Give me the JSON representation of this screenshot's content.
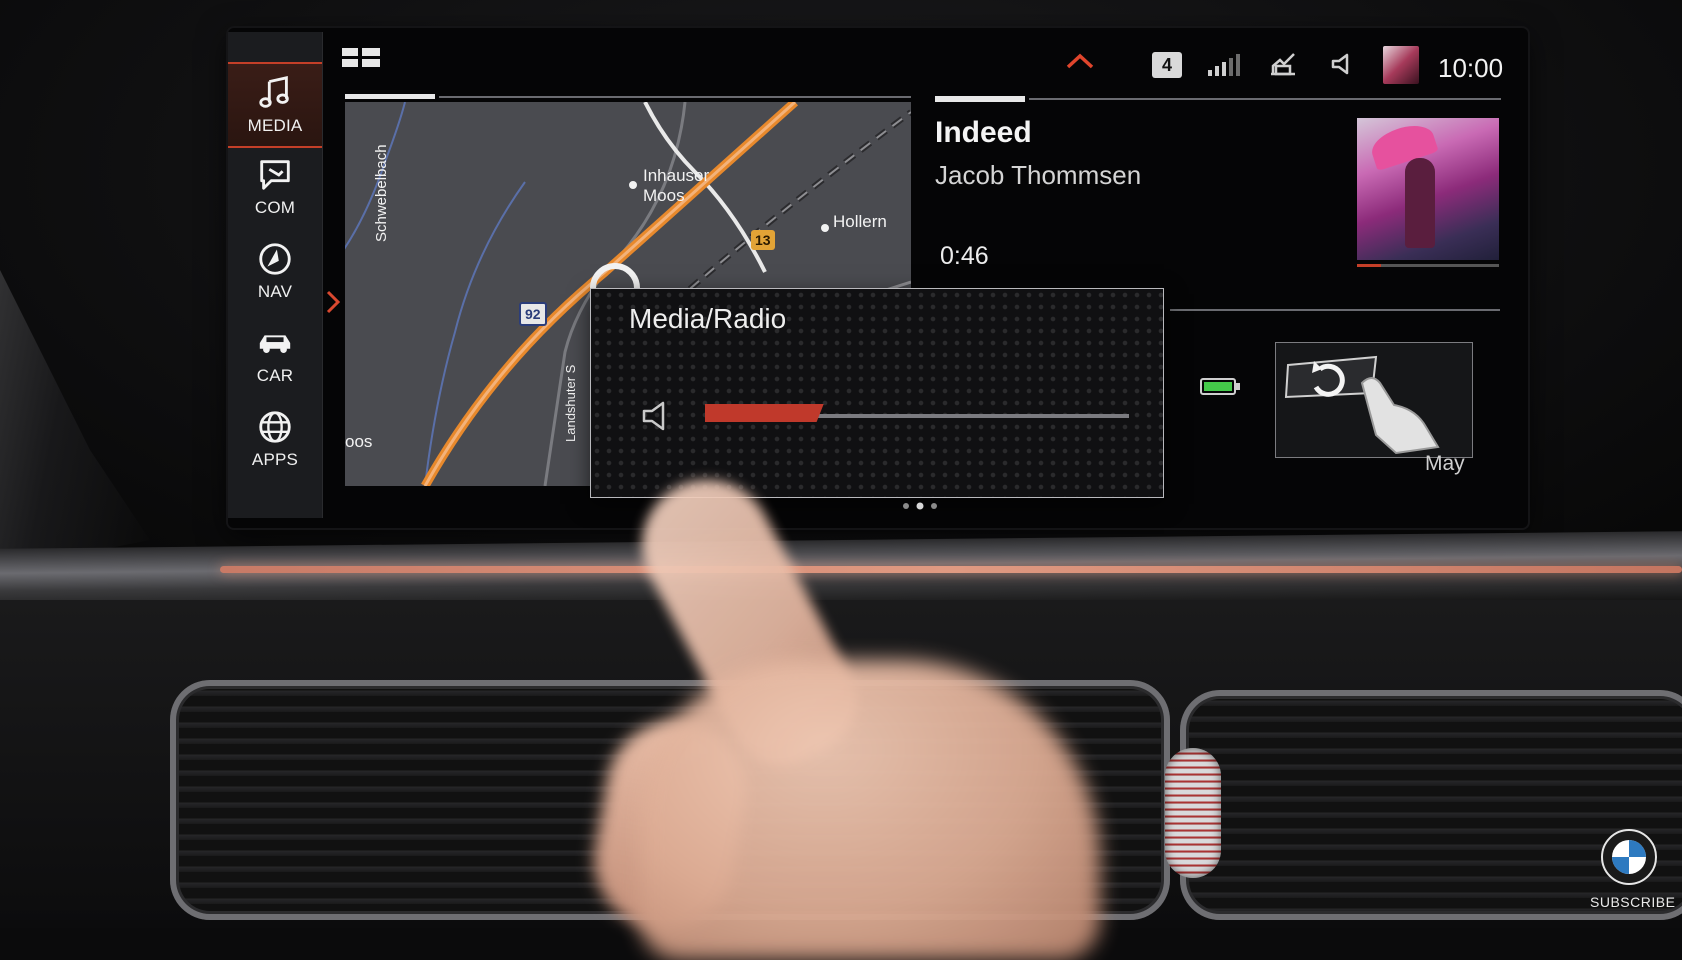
{
  "sidebar": {
    "items": [
      {
        "label": "MEDIA",
        "icon": "music-note-icon",
        "active": true
      },
      {
        "label": "COM",
        "icon": "communication-icon",
        "active": false
      },
      {
        "label": "NAV",
        "icon": "navigation-icon",
        "active": false
      },
      {
        "label": "CAR",
        "icon": "car-icon",
        "active": false
      },
      {
        "label": "APPS",
        "icon": "globe-icon",
        "active": false
      }
    ],
    "accent_color": "#c43f28"
  },
  "status_bar": {
    "badge": "4",
    "clock": "10:00",
    "icons": [
      "chevron-up-icon",
      "signal-icon",
      "phone-icon",
      "speaker-icon"
    ]
  },
  "map": {
    "labels": {
      "schwebelbach": "Schwebelbach",
      "inhauser_moos": "Inhauser Moos",
      "hollern": "Hollern",
      "landshuter": "Landshuter S",
      "moos": "oos"
    },
    "road_shields": {
      "route_92": "92",
      "route_13": "13"
    }
  },
  "now_playing": {
    "title": "Indeed",
    "artist": "Jacob Thommsen",
    "elapsed": "0:46",
    "progress": 0.17
  },
  "gesture_tile": {
    "label": "May",
    "icon": "rotate-gesture-icon"
  },
  "battery": {
    "level": 1.0,
    "color": "#44c94a"
  },
  "volume_overlay": {
    "title": "Media/Radio",
    "level": 0.28,
    "fill_color": "#c0392b"
  },
  "watermark": {
    "subscribe": "SUBSCRIBE"
  }
}
